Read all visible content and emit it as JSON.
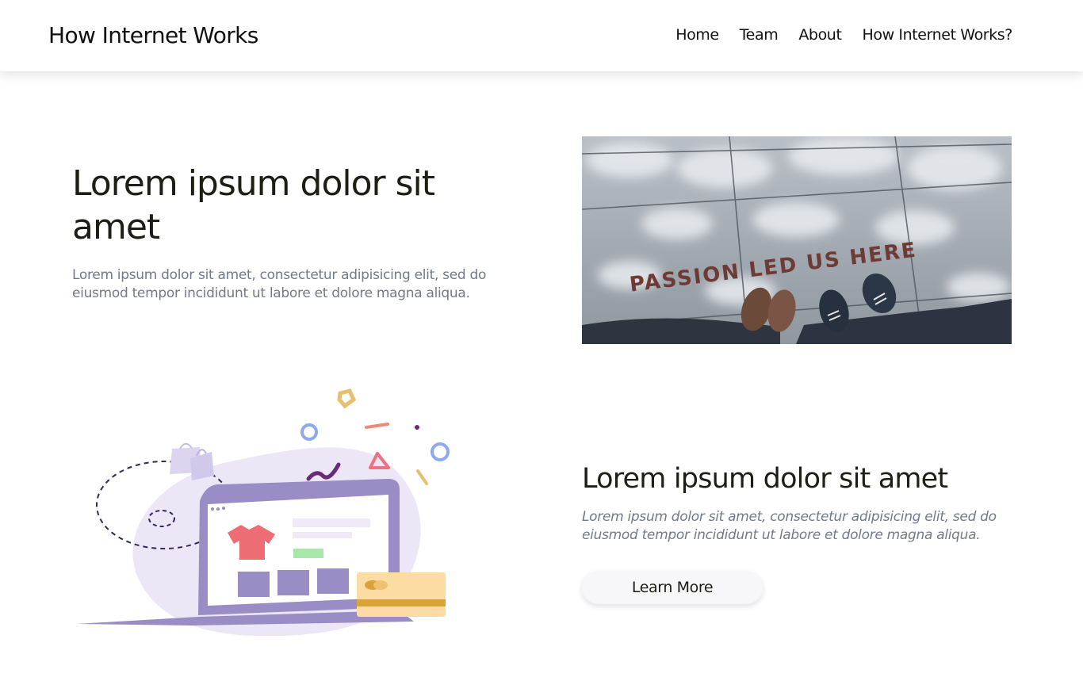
{
  "header": {
    "brand": "How Internet Works",
    "nav": [
      "Home",
      "Team",
      "About",
      "How Internet Works?"
    ]
  },
  "hero": {
    "title": "Lorem ipsum dolor sit amet",
    "text": "Lorem ipsum dolor sit amet, consectetur adipisicing elit, sed do eiusmod tempor incididunt ut labore et dolore magna aliqua.",
    "image_text": "PASSION LED US HERE"
  },
  "feature": {
    "title": "Lorem ipsum dolor sit amet",
    "text": "Lorem ipsum dolor sit amet, consectetur adipisicing elit, sed do eiusmod tempor incididunt ut labore et dolore magna aliqua.",
    "button": "Learn More"
  },
  "colors": {
    "text_dark": "#1d1f14",
    "text_muted": "#717a88",
    "illustration_purple": "#9a8cc4",
    "card_yellow": "#fddca3"
  }
}
